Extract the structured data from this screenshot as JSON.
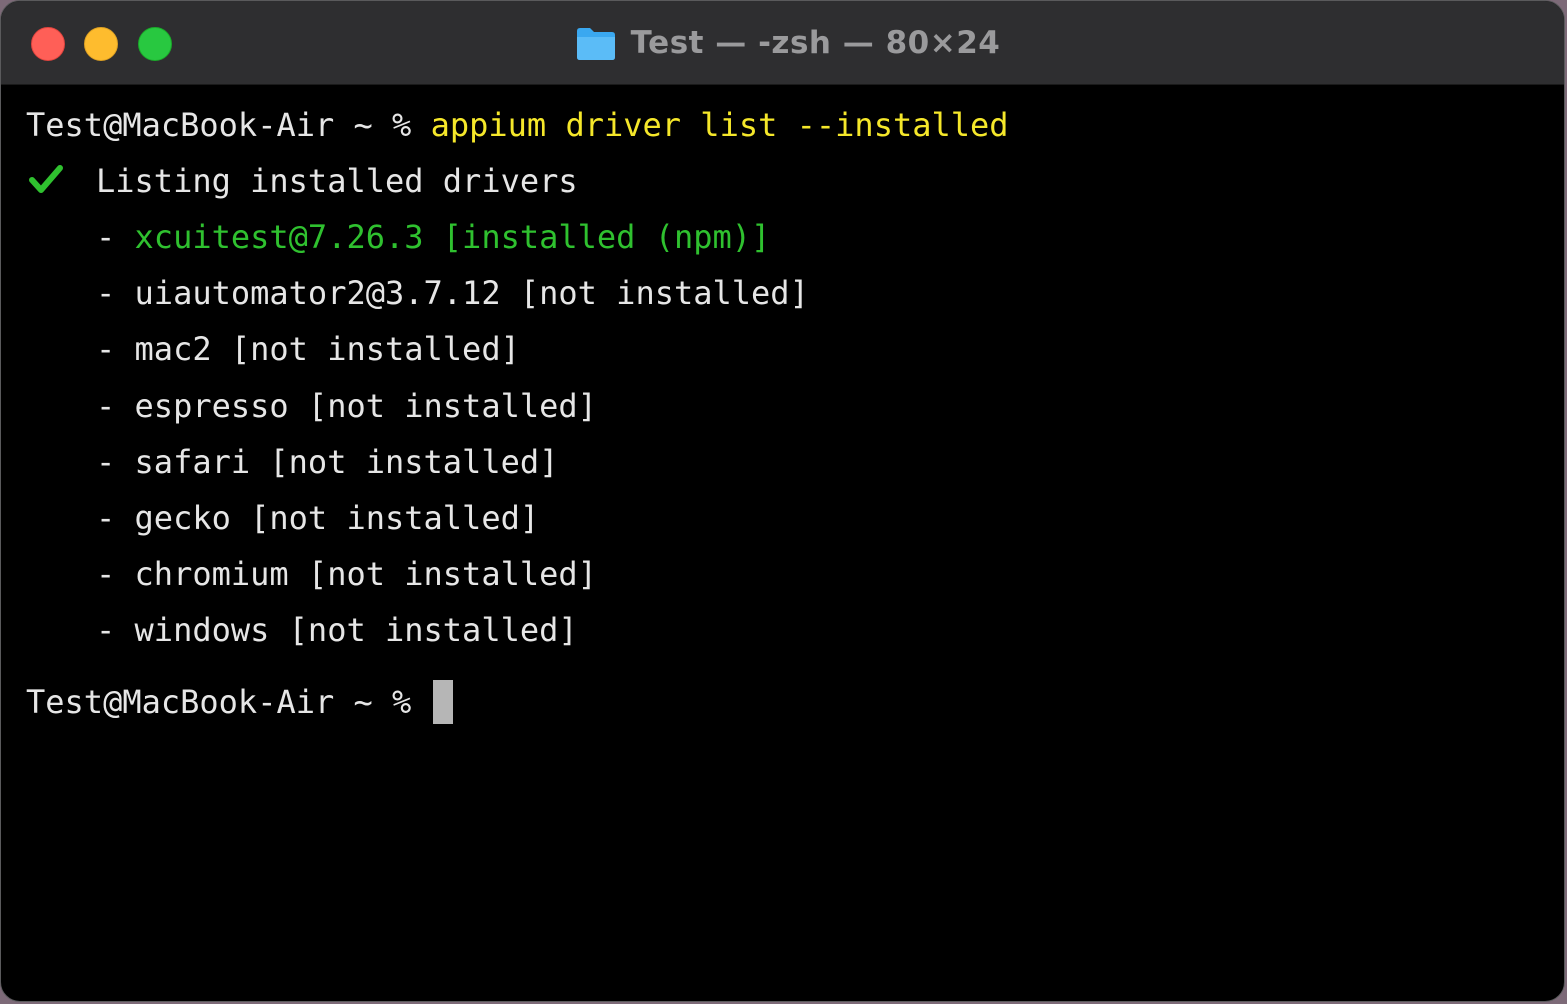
{
  "window": {
    "title": "Test — -zsh — 80×24",
    "folder_icon": "folder-icon",
    "colors": {
      "close": "#ff5f57",
      "minimize": "#febc2e",
      "zoom": "#28c840"
    }
  },
  "terminal": {
    "prompt": "Test@MacBook-Air ~ % ",
    "command": "appium driver list --installed",
    "status_icon": "checkmark-icon",
    "status_text": "Listing installed drivers",
    "drivers": [
      {
        "prefix": "- ",
        "text": "xcuitest@7.26.3 [installed (npm)]",
        "installed": true
      },
      {
        "prefix": "- ",
        "text": "uiautomator2@3.7.12 [not installed]",
        "installed": false
      },
      {
        "prefix": "- ",
        "text": "mac2 [not installed]",
        "installed": false
      },
      {
        "prefix": "- ",
        "text": "espresso [not installed]",
        "installed": false
      },
      {
        "prefix": "- ",
        "text": "safari [not installed]",
        "installed": false
      },
      {
        "prefix": "- ",
        "text": "gecko [not installed]",
        "installed": false
      },
      {
        "prefix": "- ",
        "text": "chromium [not installed]",
        "installed": false
      },
      {
        "prefix": "- ",
        "text": "windows [not installed]",
        "installed": false
      }
    ],
    "prompt2": "Test@MacBook-Air ~ % ",
    "colors": {
      "command": "#f5e72a",
      "installed": "#2fc12f",
      "text": "#e6e6e6",
      "background": "#000000"
    }
  }
}
